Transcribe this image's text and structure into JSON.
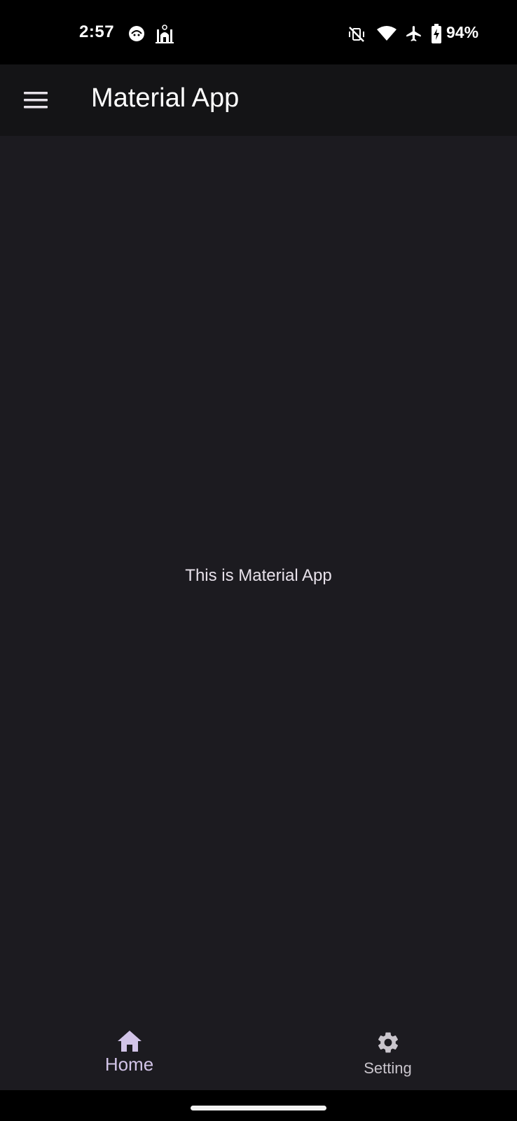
{
  "status_bar": {
    "time": "2:57",
    "battery": "94%",
    "left_icons": [
      "android-face-icon",
      "mosque-icon"
    ],
    "right_icons": [
      "vibrate-off-icon",
      "wifi-icon",
      "airplane-icon",
      "battery-charging-icon"
    ]
  },
  "app_bar": {
    "title": "Material App",
    "menu_icon": "hamburger-menu-icon"
  },
  "body": {
    "text": "This is Material App"
  },
  "bottom_nav": {
    "items": [
      {
        "label": "Home",
        "icon": "home-icon",
        "selected": true
      },
      {
        "label": "Setting",
        "icon": "gear-icon",
        "selected": false
      }
    ]
  },
  "colors": {
    "background": "#1c1b20",
    "app_bar": "#141416",
    "accent": "#d2c4e8"
  }
}
